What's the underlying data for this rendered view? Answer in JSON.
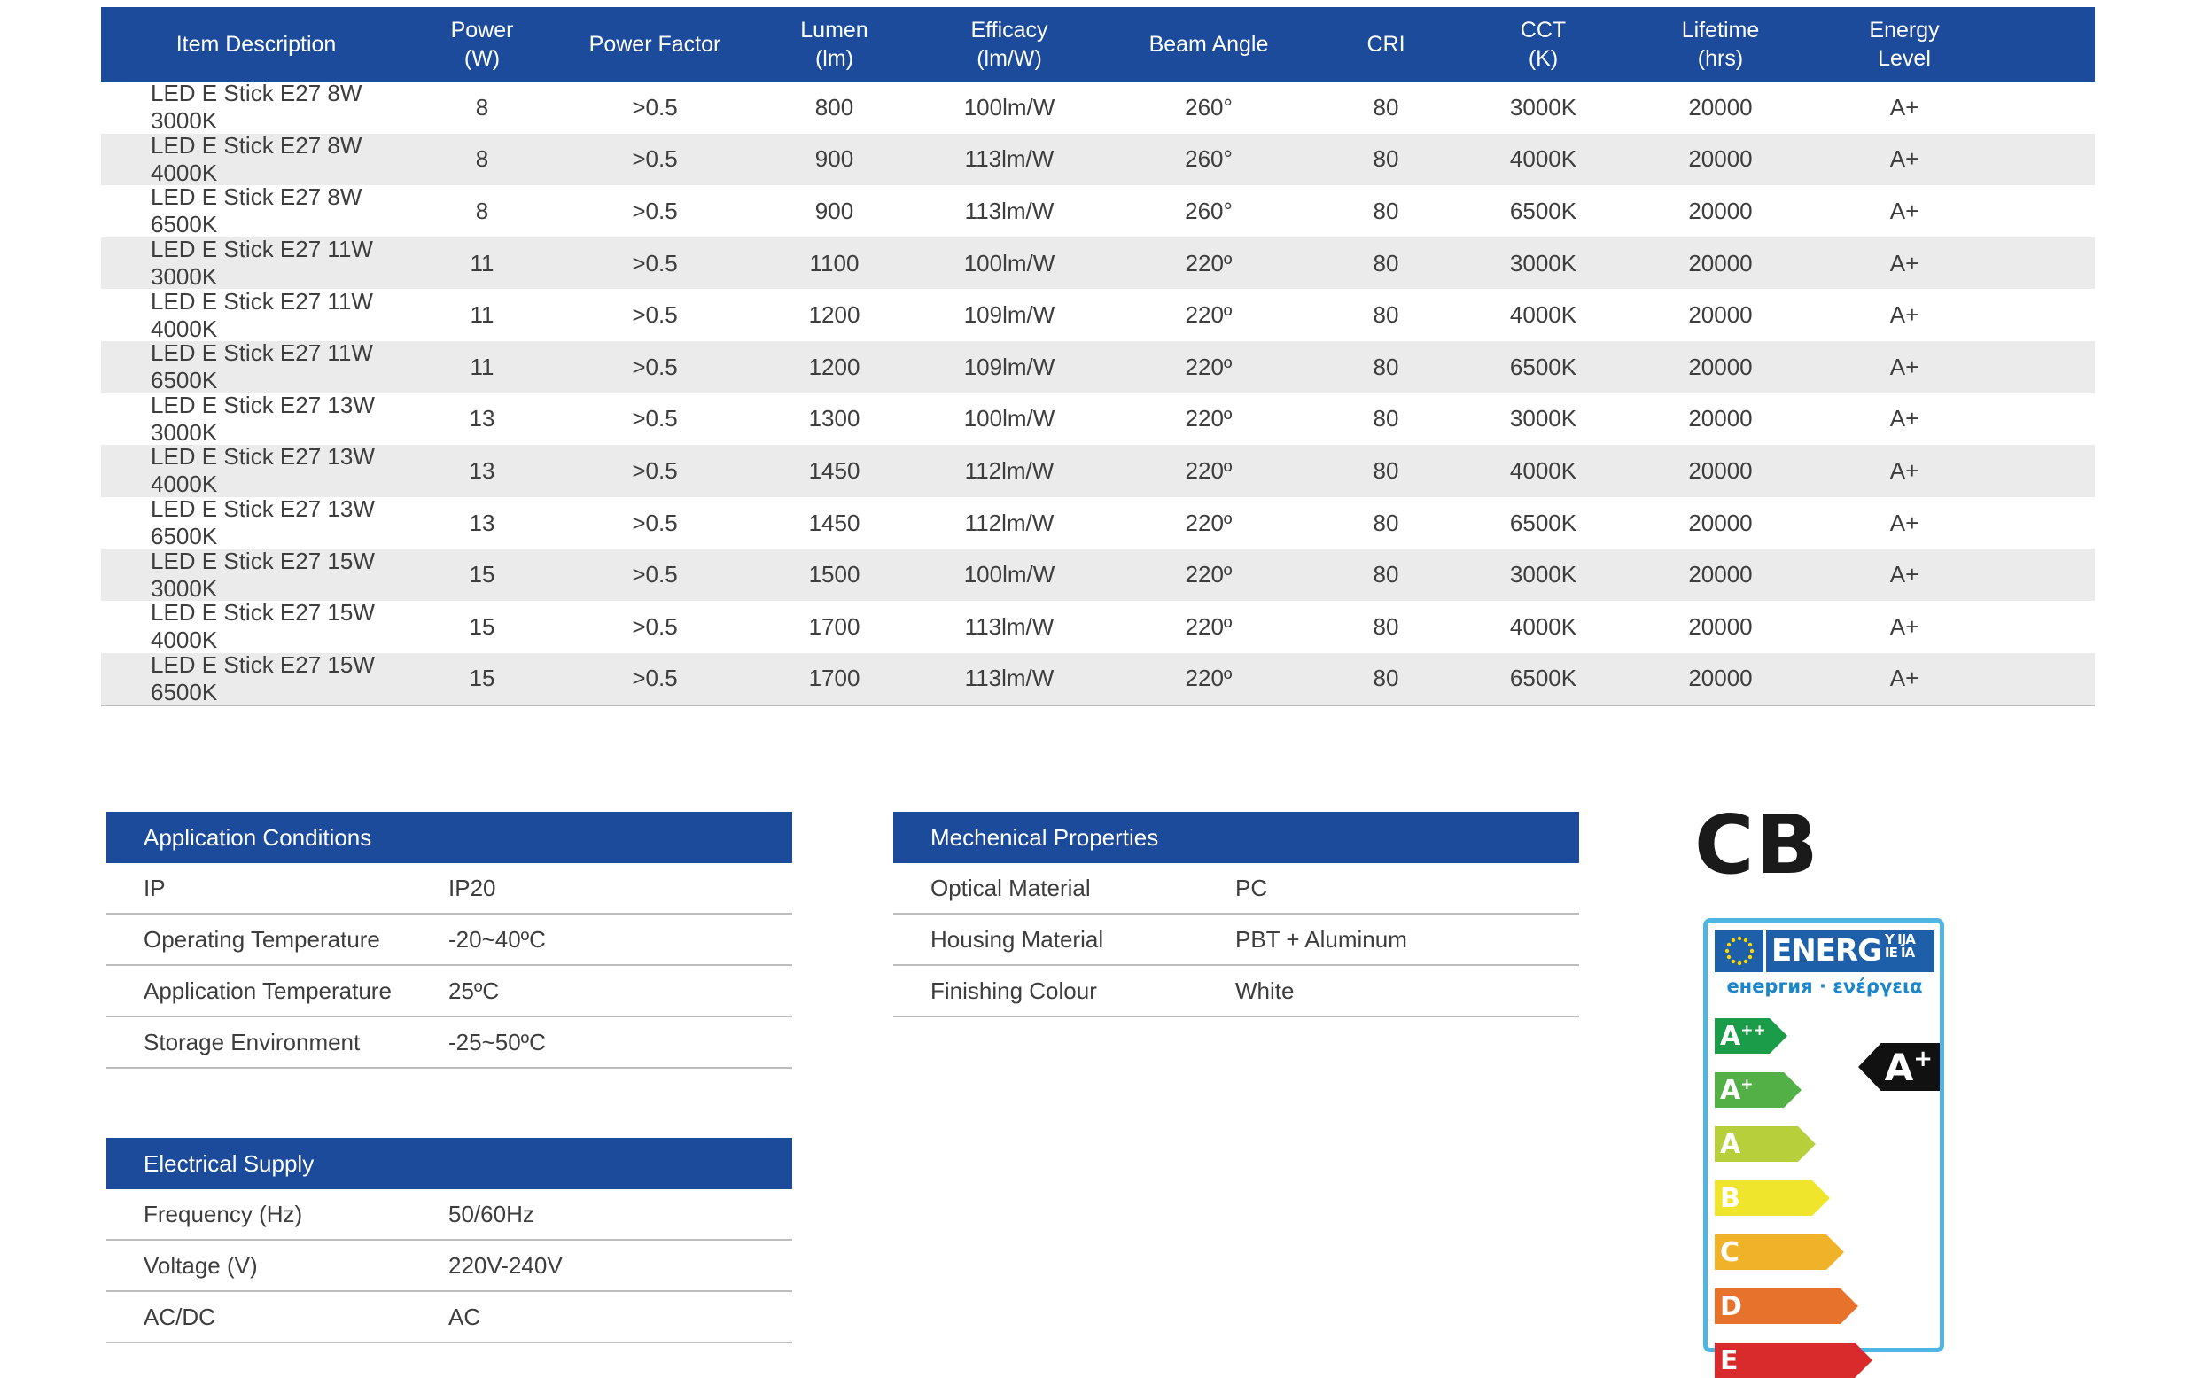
{
  "spec_table": {
    "headers": [
      {
        "line1": "Item Description",
        "line2": ""
      },
      {
        "line1": "Power",
        "line2": "(W)"
      },
      {
        "line1": "Power Factor",
        "line2": ""
      },
      {
        "line1": "Lumen",
        "line2": "(lm)"
      },
      {
        "line1": "Efficacy",
        "line2": "(lm/W)"
      },
      {
        "line1": "Beam Angle",
        "line2": ""
      },
      {
        "line1": "CRI",
        "line2": ""
      },
      {
        "line1": "CCT",
        "line2": "(K)"
      },
      {
        "line1": "Lifetime",
        "line2": "(hrs)"
      },
      {
        "line1": "Energy",
        "line2": "Level"
      }
    ],
    "rows": [
      [
        "LED E Stick E27 8W 3000K",
        "8",
        ">0.5",
        "800",
        "100lm/W",
        "260°",
        "80",
        "3000K",
        "20000",
        "A+"
      ],
      [
        "LED E Stick E27 8W 4000K",
        "8",
        ">0.5",
        "900",
        "113lm/W",
        "260°",
        "80",
        "4000K",
        "20000",
        "A+"
      ],
      [
        "LED E Stick E27 8W 6500K",
        "8",
        ">0.5",
        "900",
        "113lm/W",
        "260°",
        "80",
        "6500K",
        "20000",
        "A+"
      ],
      [
        "LED E Stick E27 11W 3000K",
        "11",
        ">0.5",
        "1100",
        "100lm/W",
        "220º",
        "80",
        "3000K",
        "20000",
        "A+"
      ],
      [
        "LED E Stick E27 11W 4000K",
        "11",
        ">0.5",
        "1200",
        "109lm/W",
        "220º",
        "80",
        "4000K",
        "20000",
        "A+"
      ],
      [
        "LED E Stick E27 11W 6500K",
        "11",
        ">0.5",
        "1200",
        "109lm/W",
        "220º",
        "80",
        "6500K",
        "20000",
        "A+"
      ],
      [
        "LED E Stick E27 13W 3000K",
        "13",
        ">0.5",
        "1300",
        "100lm/W",
        "220º",
        "80",
        "3000K",
        "20000",
        "A+"
      ],
      [
        "LED E Stick E27 13W 4000K",
        "13",
        ">0.5",
        "1450",
        "112lm/W",
        "220º",
        "80",
        "4000K",
        "20000",
        "A+"
      ],
      [
        "LED E Stick E27 13W 6500K",
        "13",
        ">0.5",
        "1450",
        "112lm/W",
        "220º",
        "80",
        "6500K",
        "20000",
        "A+"
      ],
      [
        "LED E Stick E27 15W 3000K",
        "15",
        ">0.5",
        "1500",
        "100lm/W",
        "220º",
        "80",
        "3000K",
        "20000",
        "A+"
      ],
      [
        "LED E Stick E27 15W 4000K",
        "15",
        ">0.5",
        "1700",
        "113lm/W",
        "220º",
        "80",
        "4000K",
        "20000",
        "A+"
      ],
      [
        "LED E Stick E27 15W 6500K",
        "15",
        ">0.5",
        "1700",
        "113lm/W",
        "220º",
        "80",
        "6500K",
        "20000",
        "A+"
      ]
    ]
  },
  "application_conditions": {
    "title": "Application Conditions",
    "rows": [
      {
        "key": "IP",
        "value": "IP20"
      },
      {
        "key": "Operating Temperature",
        "value": "-20~40ºC"
      },
      {
        "key": "Application Temperature",
        "value": "25ºC"
      },
      {
        "key": "Storage Environment",
        "value": "-25~50ºC"
      }
    ]
  },
  "electrical_supply": {
    "title": "Electrical Supply",
    "rows": [
      {
        "key": "Frequency (Hz)",
        "value": "50/60Hz"
      },
      {
        "key": "Voltage (V)",
        "value": "220V-240V"
      },
      {
        "key": "AC/DC",
        "value": "AC"
      }
    ]
  },
  "mechanical_properties": {
    "title": "Mechenical Properties",
    "rows": [
      {
        "key": "Optical Material",
        "value": "PC"
      },
      {
        "key": "Housing Material",
        "value": "PBT + Aluminum"
      },
      {
        "key": "Finishing Colour",
        "value": "White"
      }
    ]
  },
  "cb_mark": "CB",
  "energy_label": {
    "title": "ENERG",
    "title_suffix_1": "Y IJA",
    "title_suffix_2": "IE IA",
    "subtitle": "енергия · ενέργεια",
    "classes": [
      {
        "letter": "A",
        "sup": "++",
        "color": "#1a9c48"
      },
      {
        "letter": "A",
        "sup": "+",
        "color": "#52b047"
      },
      {
        "letter": "A",
        "sup": "",
        "color": "#b7cf3a"
      },
      {
        "letter": "B",
        "sup": "",
        "color": "#eee52c"
      },
      {
        "letter": "C",
        "sup": "",
        "color": "#f0b229"
      },
      {
        "letter": "D",
        "sup": "",
        "color": "#e7722c"
      },
      {
        "letter": "E",
        "sup": "",
        "color": "#d92b2b"
      }
    ],
    "rating_letter": "A",
    "rating_sup": "+"
  },
  "colors": {
    "header_blue": "#1c4b9c",
    "row_alt": "#ebebeb",
    "label_border": "#4fb6e3"
  }
}
